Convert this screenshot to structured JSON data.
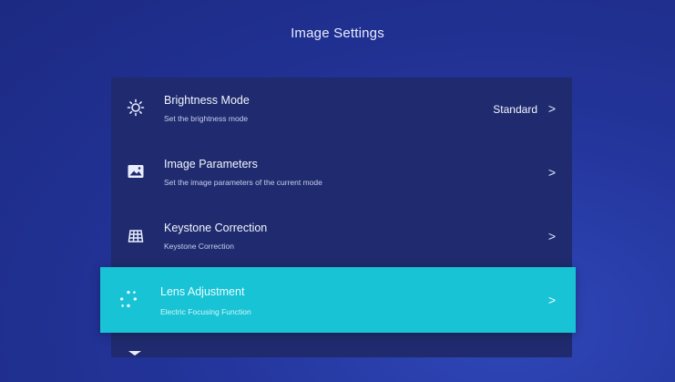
{
  "header": {
    "title": "Image Settings"
  },
  "menu": [
    {
      "label": "Brightness Mode",
      "subtitle": "Set the brightness mode",
      "value": "Standard",
      "icon": "sun-icon"
    },
    {
      "label": "Image Parameters",
      "subtitle": "Set the image parameters of the current mode",
      "value": "",
      "icon": "image-icon"
    },
    {
      "label": "Keystone Correction",
      "subtitle": "Keystone Correction",
      "value": "",
      "icon": "grid-icon"
    },
    {
      "label": "Lens Adjustment",
      "subtitle": "Electric Focusing Function",
      "value": "",
      "icon": "focus-dots-icon",
      "selected": true
    }
  ],
  "chevron": ">",
  "colors": {
    "background": "#23349a",
    "panel": "#1f2b6e",
    "selected": "#17c3d5"
  }
}
